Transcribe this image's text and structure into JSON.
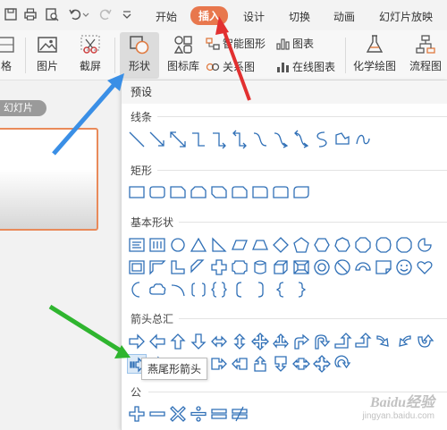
{
  "menu": {
    "tabs": [
      "开始",
      "插入",
      "设计",
      "切换",
      "动画",
      "幻灯片放映"
    ],
    "active_tab": "插入"
  },
  "ribbon": {
    "partial_left": "格",
    "picture": "图片",
    "screenshot": "截屏",
    "shapes": "形状",
    "icon_library": "图标库",
    "smart_art": "智能图形",
    "chart": "图表",
    "relation_chart": "关系图",
    "online_chart": "在线图表",
    "chem_draw": "化学绘图",
    "flowchart": "流程图"
  },
  "left_panel": {
    "slides_tab": "幻灯片"
  },
  "dropdown": {
    "preset": "预设",
    "sections": {
      "lines": "线条",
      "rects": "矩形",
      "basic": "基本形状",
      "arrows": "箭头总汇",
      "formula_partial": "公"
    }
  },
  "tooltip": "燕尾形箭头",
  "watermark": {
    "main": "Baidu经验",
    "sub": "jingyan.baidu.com"
  },
  "colors": {
    "accent": "#e8774d",
    "shape_stroke": "#2f6fb6",
    "blue_arrow": "#3a8fe6",
    "red_arrow": "#e23030",
    "green_arrow": "#2fb52f"
  }
}
